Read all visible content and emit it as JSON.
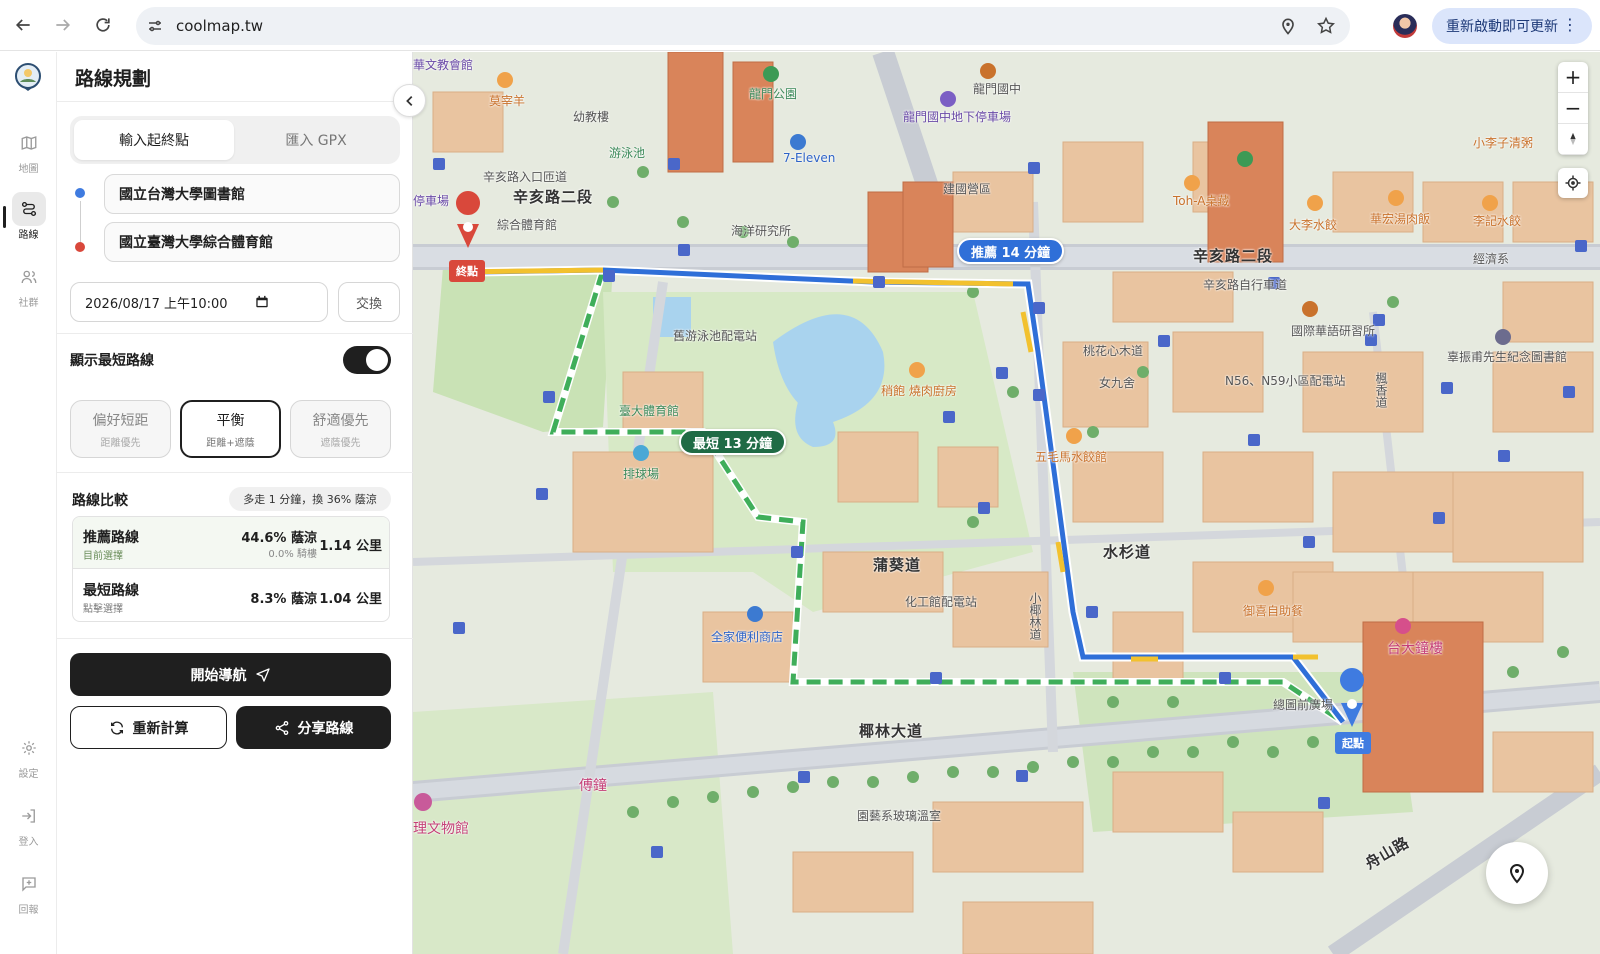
{
  "browser": {
    "url": "coolmap.tw",
    "update_label": "重新啟動即可更新"
  },
  "rail": {
    "items": [
      {
        "label": "地圖"
      },
      {
        "label": "路線"
      },
      {
        "label": "社群"
      },
      {
        "label": "設定"
      },
      {
        "label": "登入"
      },
      {
        "label": "回報"
      }
    ]
  },
  "panel": {
    "title": "路線規劃",
    "tabs": [
      {
        "label": "輸入起終點"
      },
      {
        "label": "匯入 GPX"
      }
    ],
    "origin": "國立台灣大學圖書館",
    "destination": "國立臺灣大學綜合體育館",
    "datetime": "2026/08/17 上午10:00",
    "swap_label": "交換",
    "shortest_toggle_label": "顯示最短路線",
    "shortest_toggle_on": true,
    "modes": [
      {
        "label": "偏好短距",
        "sub": "距離優先"
      },
      {
        "label": "平衡",
        "sub": "距離+遮蔭"
      },
      {
        "label": "舒適優先",
        "sub": "遮蔭優先"
      }
    ],
    "compare": {
      "title": "路線比較",
      "badge": "多走 1 分鐘，換 36% 蔭涼",
      "rows": [
        {
          "name": "推薦路線",
          "sub": "目前選擇",
          "shade": "44.6% 蔭涼",
          "arcade": "0.0% 騎樓",
          "distance": "1.14 公里"
        },
        {
          "name": "最短路線",
          "sub": "點擊選擇",
          "shade": "8.3% 蔭涼",
          "distance": "1.04 公里"
        }
      ]
    },
    "start_nav_label": "開始導航",
    "recalc_label": "重新計算",
    "share_label": "分享路線"
  },
  "map": {
    "chips": {
      "recommended": "推薦 14 分鐘",
      "shortest": "最短 13 分鐘"
    },
    "end_label": "終點",
    "start_label": "起點",
    "labels": {
      "xinhai_rd": "辛亥路二段",
      "xinhai_rd_east": "辛亥路二段",
      "xinhai_bike": "辛亥路自行車道",
      "xinhai_entrance": "辛亥路入口匝道",
      "palm_ave": "椰林大道",
      "shuishan": "水杉道",
      "puqui": "蒲葵道",
      "xiaoye": "小椰林道",
      "taohua": "桃花心木道",
      "gym": "綜合體育館",
      "ocean": "海洋研究所",
      "ntu_gym": "臺大體育館",
      "volley": "排球場",
      "nuyouyong": "舊游泳池配電站",
      "chem": "化工館配電站",
      "familymart": "全家便利商店",
      "bell_tower": "台大鐘樓",
      "fu_bell": "傅鐘",
      "glasshouse": "園藝系玻璃溫室",
      "museum": "理文物館",
      "n56": "N56、N59小區配電站",
      "women9": "女九舍",
      "shaobao": "稍飽 燒肉廚房",
      "wuhua": "五毛馬水餃館",
      "yuxi": "御喜自助餐",
      "longmen_park": "龍門公園",
      "longmen_jr": "龍門國中",
      "longmen_park_lot": "龍門國中地下停車場",
      "seven": "7-Eleven",
      "jianxiu": "建國營區",
      "tohai": "Toh-A桌藏",
      "daqian": "大李水餃",
      "huahong": "華宏湯肉飯",
      "lijiwonton": "李記水餃",
      "littlelee": "小李子清粥",
      "jingji": "經濟系",
      "mandarin": "國際華語研習所",
      "yilan": "辜振甫先生紀念圖書館",
      "youyong": "游泳池",
      "kindergarten": "幼教樓",
      "parking": "停車場",
      "wenjiao": "華文教會館",
      "guangchang": "總圖前廣場",
      "zhoushan": "舟山路",
      "fengyuan": "楓香道",
      "mozhuan": "莫宰羊"
    }
  },
  "colors": {
    "recommended": "#2f6fd8",
    "shortest": "#3fae5a",
    "yellow_segment": "#f2c12e",
    "building_orange": "#d9845a",
    "building_tan": "#e9c4a0"
  }
}
